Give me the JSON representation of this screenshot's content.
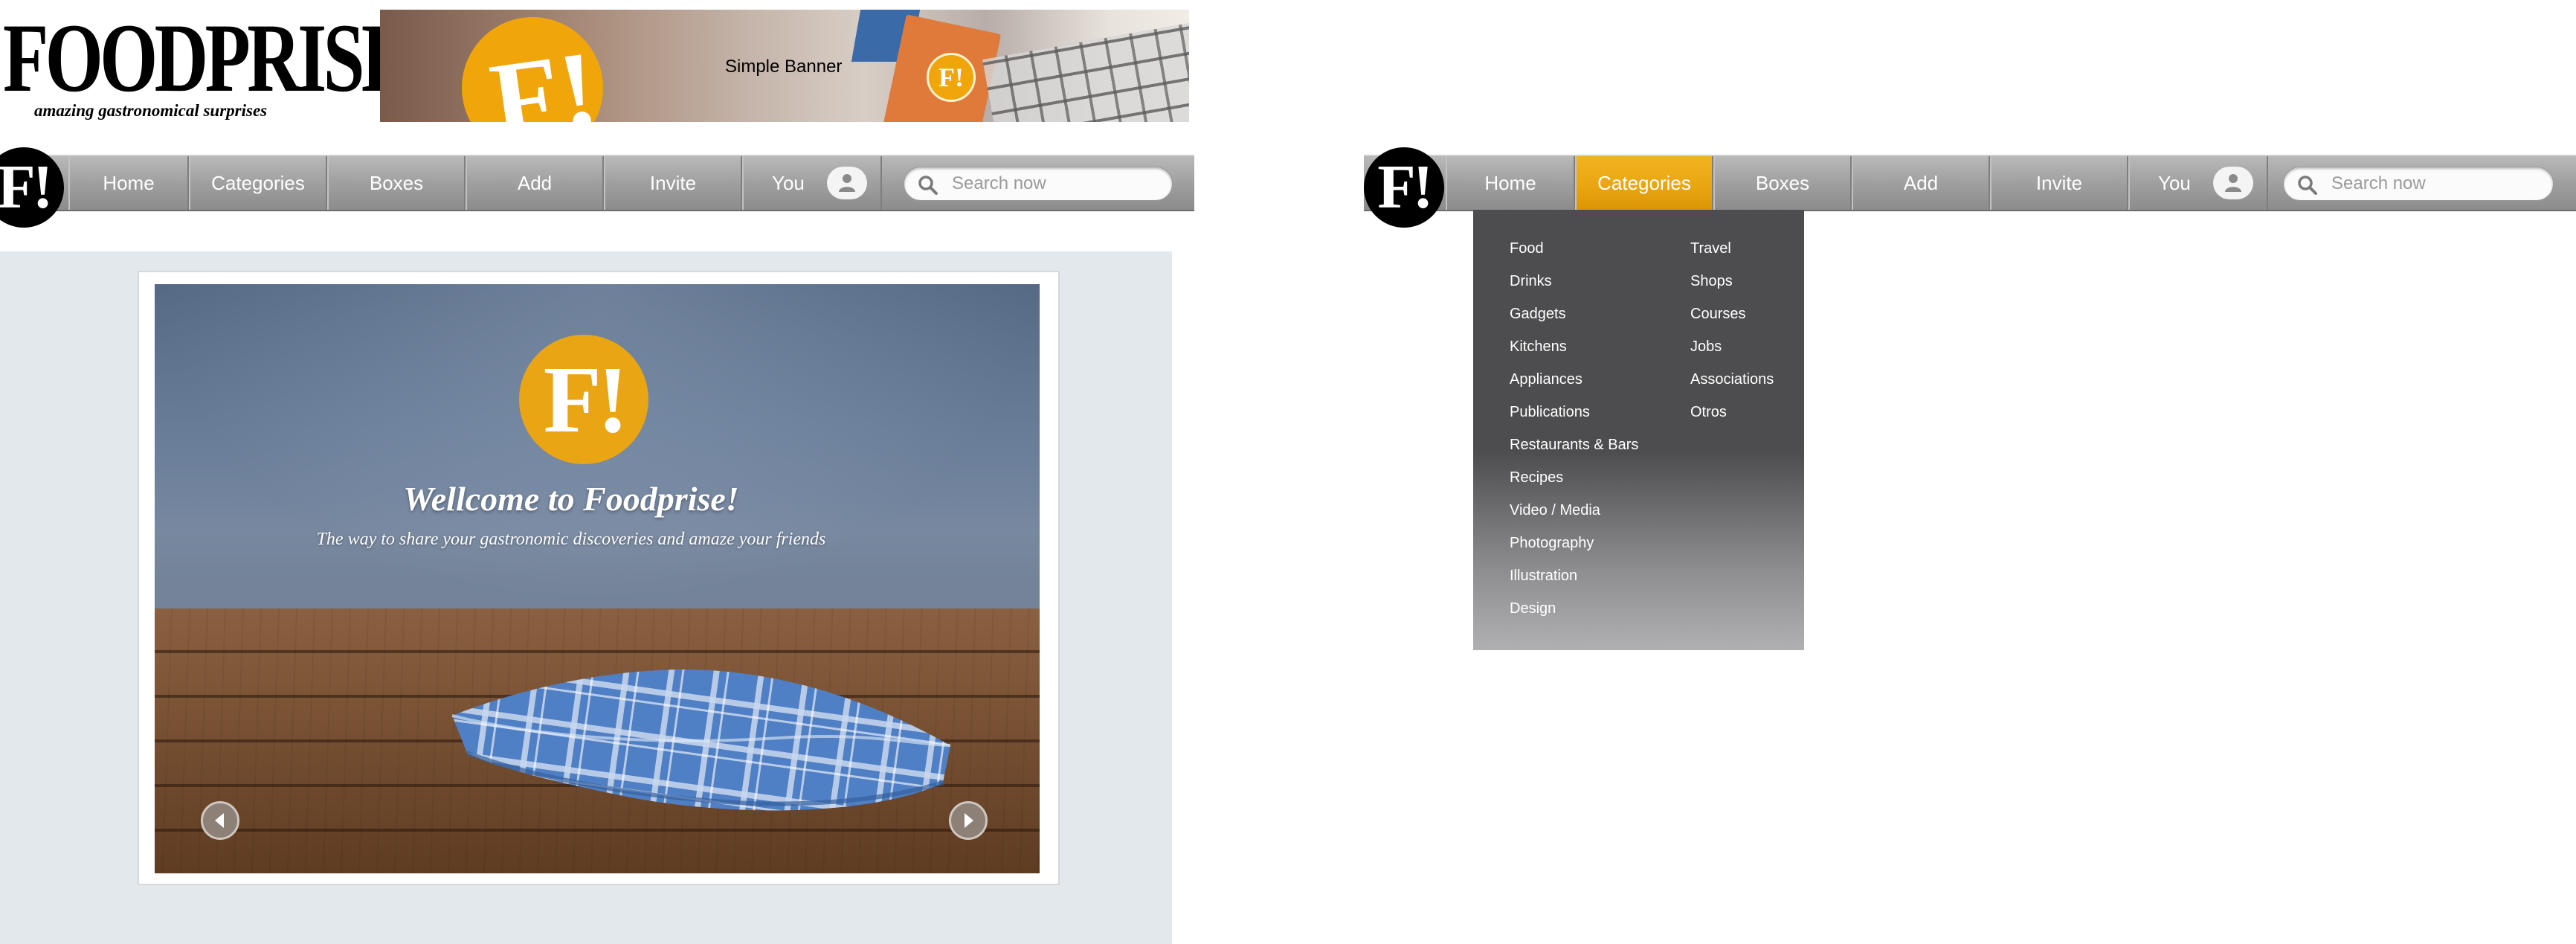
{
  "brand": {
    "name": "FOODPRISE!",
    "tagline": "amazing gastronomical surprises",
    "logo_mark": "F!"
  },
  "banner": {
    "label": "Simple Banner"
  },
  "nav": {
    "items": [
      {
        "label": "Home"
      },
      {
        "label": "Categories"
      },
      {
        "label": "Boxes"
      },
      {
        "label": "Add"
      },
      {
        "label": "Invite"
      },
      {
        "label": "You"
      }
    ],
    "active_in_second_bar": "Categories",
    "search_placeholder": "Search now",
    "user_icon": "user-icon",
    "search_icon": "search-icon"
  },
  "slider": {
    "logo_mark": "F!",
    "title": "Wellcome to Foodprise!",
    "subtitle": "The way to share your gastronomic discoveries and amaze your friends",
    "prev_icon": "chevron-left-icon",
    "next_icon": "chevron-right-icon"
  },
  "categories_menu": {
    "column_a": [
      "Food",
      "Drinks",
      "Gadgets",
      "Kitchens",
      "Appliances",
      "Publications",
      "Restaurants & Bars",
      "Recipes",
      "Video / Media",
      "Photography",
      "Illustration",
      "Design"
    ],
    "column_b": [
      "Travel",
      "Shops",
      "Courses",
      "Jobs",
      "Associations",
      "Otros"
    ]
  },
  "colors": {
    "accent": "#e9a514",
    "nav_bar": "#a2a2a2",
    "dropdown": "#4d4d4f",
    "content_bg": "#e3e8ec",
    "logo_circle": "#000000"
  }
}
